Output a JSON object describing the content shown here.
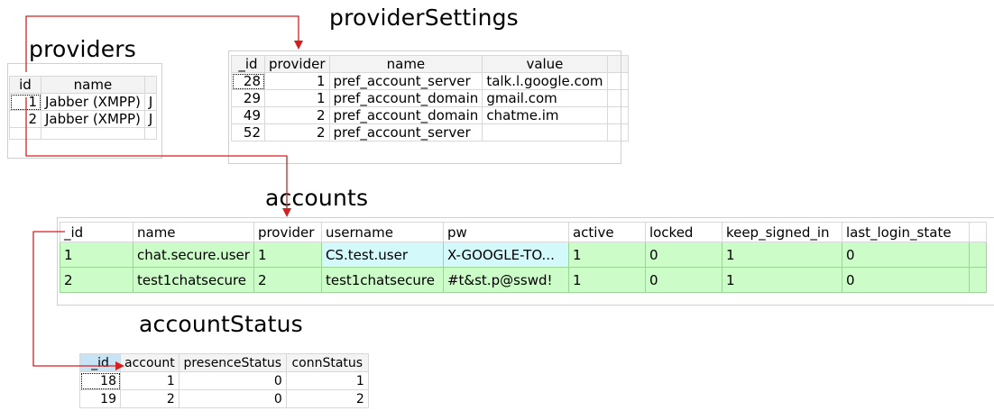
{
  "titles": {
    "providerSettings": "providerSettings",
    "providers": "providers",
    "accounts": "accounts",
    "accountStatus": "accountStatus"
  },
  "providers": {
    "columns": [
      "id",
      "name"
    ],
    "rows": [
      {
        "id": "1",
        "name": "Jabber (XMPP)",
        "extra": "J"
      },
      {
        "id": "2",
        "name": "Jabber (XMPP)",
        "extra": "J"
      }
    ]
  },
  "providerSettings": {
    "columns": [
      "_id",
      "provider",
      "name",
      "value"
    ],
    "rows": [
      {
        "_id": "28",
        "provider": "1",
        "name": "pref_account_server",
        "value": "talk.l.google.com"
      },
      {
        "_id": "29",
        "provider": "1",
        "name": "pref_account_domain",
        "value": "gmail.com"
      },
      {
        "_id": "49",
        "provider": "2",
        "name": "pref_account_domain",
        "value": "chatme.im"
      },
      {
        "_id": "52",
        "provider": "2",
        "name": "pref_account_server",
        "value": ""
      }
    ]
  },
  "accounts": {
    "columns": [
      "_id",
      "name",
      "provider",
      "username",
      "pw",
      "active",
      "locked",
      "keep_signed_in",
      "last_login_state"
    ],
    "rows": [
      {
        "_id": "1",
        "name": "chat.secure.user",
        "provider": "1",
        "username": "CS.test.user",
        "pw": "X-GOOGLE-TO...",
        "active": "1",
        "locked": "0",
        "keep_signed_in": "1",
        "last_login_state": "0"
      },
      {
        "_id": "2",
        "name": "test1chatsecure",
        "provider": "2",
        "username": "test1chatsecure",
        "pw": "#t&st.p@sswd!",
        "active": "1",
        "locked": "0",
        "keep_signed_in": "1",
        "last_login_state": "0"
      }
    ]
  },
  "accountStatus": {
    "columns": [
      "_id",
      "account",
      "presenceStatus",
      "connStatus"
    ],
    "rows": [
      {
        "_id": "18",
        "account": "1",
        "presenceStatus": "0",
        "connStatus": "1"
      },
      {
        "_id": "19",
        "account": "2",
        "presenceStatus": "0",
        "connStatus": "2"
      }
    ]
  },
  "colors": {
    "arrow": "#d42020",
    "account_row_bg": "#ccfcc8",
    "cyan_cell_bg": "#d4f9fb",
    "selected_header_bg": "#c6e4f5"
  }
}
